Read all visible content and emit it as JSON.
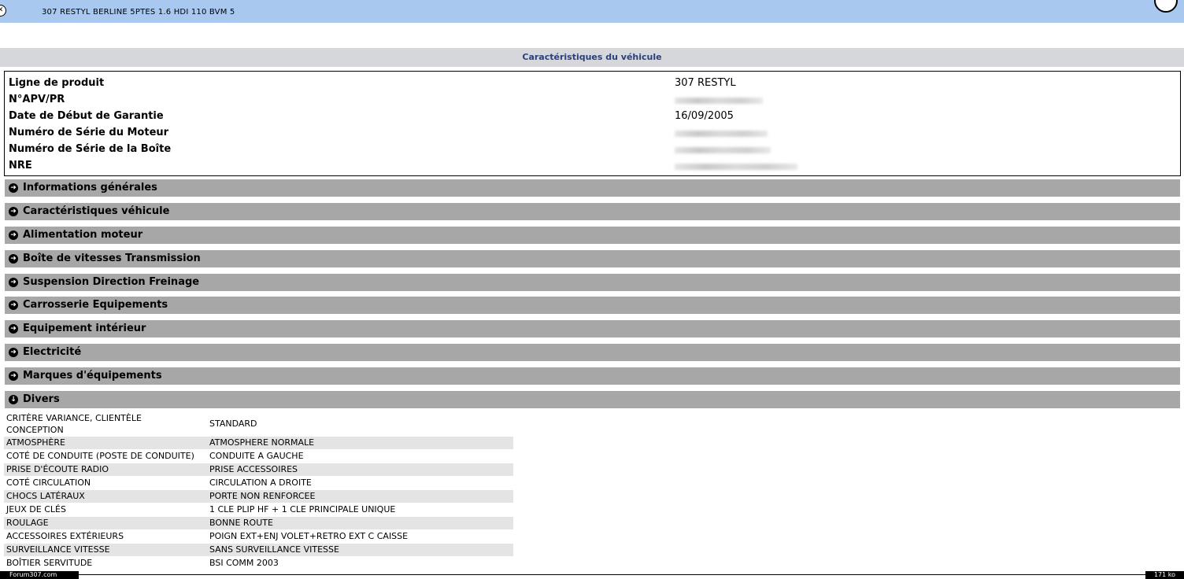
{
  "window": {
    "title": "307 RESTYL BERLINE 5PTES 1.6 HDI 110 BVM 5",
    "close_glyph": "✕"
  },
  "header": {
    "title": "Caractéristiques du véhicule"
  },
  "info": [
    {
      "label": "Ligne de produit",
      "value": "307 RESTYL"
    },
    {
      "label": "N°APV/PR",
      "value": ""
    },
    {
      "label": "Date de Début de Garantie",
      "value": "16/09/2005"
    },
    {
      "label": "Numéro de Série du Moteur",
      "value": ""
    },
    {
      "label": "Numéro de Série de la Boîte",
      "value": ""
    },
    {
      "label": "NRE",
      "value": ""
    }
  ],
  "categories": [
    {
      "label": "Informations générales",
      "icon": "arrow-right-icon",
      "glyph": "➜"
    },
    {
      "label": "Caractéristiques véhicule",
      "icon": "arrow-right-icon",
      "glyph": "➜"
    },
    {
      "label": "Alimentation moteur",
      "icon": "arrow-right-icon",
      "glyph": "➜"
    },
    {
      "label": "Boîte de vitesses Transmission",
      "icon": "arrow-right-icon",
      "glyph": "➜"
    },
    {
      "label": "Suspension Direction Freinage",
      "icon": "arrow-right-icon",
      "glyph": "➜"
    },
    {
      "label": "Carrosserie Equipements",
      "icon": "arrow-right-icon",
      "glyph": "➜"
    },
    {
      "label": "Equipement intérieur",
      "icon": "arrow-right-icon",
      "glyph": "➜"
    },
    {
      "label": "Electricité",
      "icon": "arrow-right-icon",
      "glyph": "➜"
    },
    {
      "label": "Marques d'équipements",
      "icon": "arrow-right-icon",
      "glyph": "➜"
    },
    {
      "label": "Divers",
      "icon": "arrow-down-icon",
      "glyph": "↓"
    }
  ],
  "divers": [
    {
      "key": "CRITÈRE VARIANCE, CLIENTÈLE CONCEPTION",
      "value": "STANDARD"
    },
    {
      "key": "ATMOSPHÈRE",
      "value": "ATMOSPHERE NORMALE"
    },
    {
      "key": "COTÉ DE CONDUITE (POSTE DE CONDUITE)",
      "value": "CONDUITE A GAUCHE"
    },
    {
      "key": "PRISE D'ÉCOUTE RADIO",
      "value": "PRISE ACCESSOIRES"
    },
    {
      "key": "COTÉ CIRCULATION",
      "value": "CIRCULATION A DROITE"
    },
    {
      "key": "CHOCS LATÉRAUX",
      "value": "PORTE NON RENFORCEE"
    },
    {
      "key": "JEUX DE CLÉS",
      "value": "1 CLE PLIP HF + 1 CLE PRINCIPALE UNIQUE"
    },
    {
      "key": "ROULAGE",
      "value": "BONNE ROUTE"
    },
    {
      "key": "ACCESSOIRES EXTÉRIEURS",
      "value": "POIGN EXT+ENJ VOLET+RETRO EXT C CAISSE"
    },
    {
      "key": "SURVEILLANCE VITESSE",
      "value": "SANS SURVEILLANCE VITESSE"
    },
    {
      "key": "BOÎTIER SERVITUDE",
      "value": "BSI COMM 2003"
    }
  ],
  "footer": {
    "left": "Forum307.com",
    "right": "171 ko"
  }
}
